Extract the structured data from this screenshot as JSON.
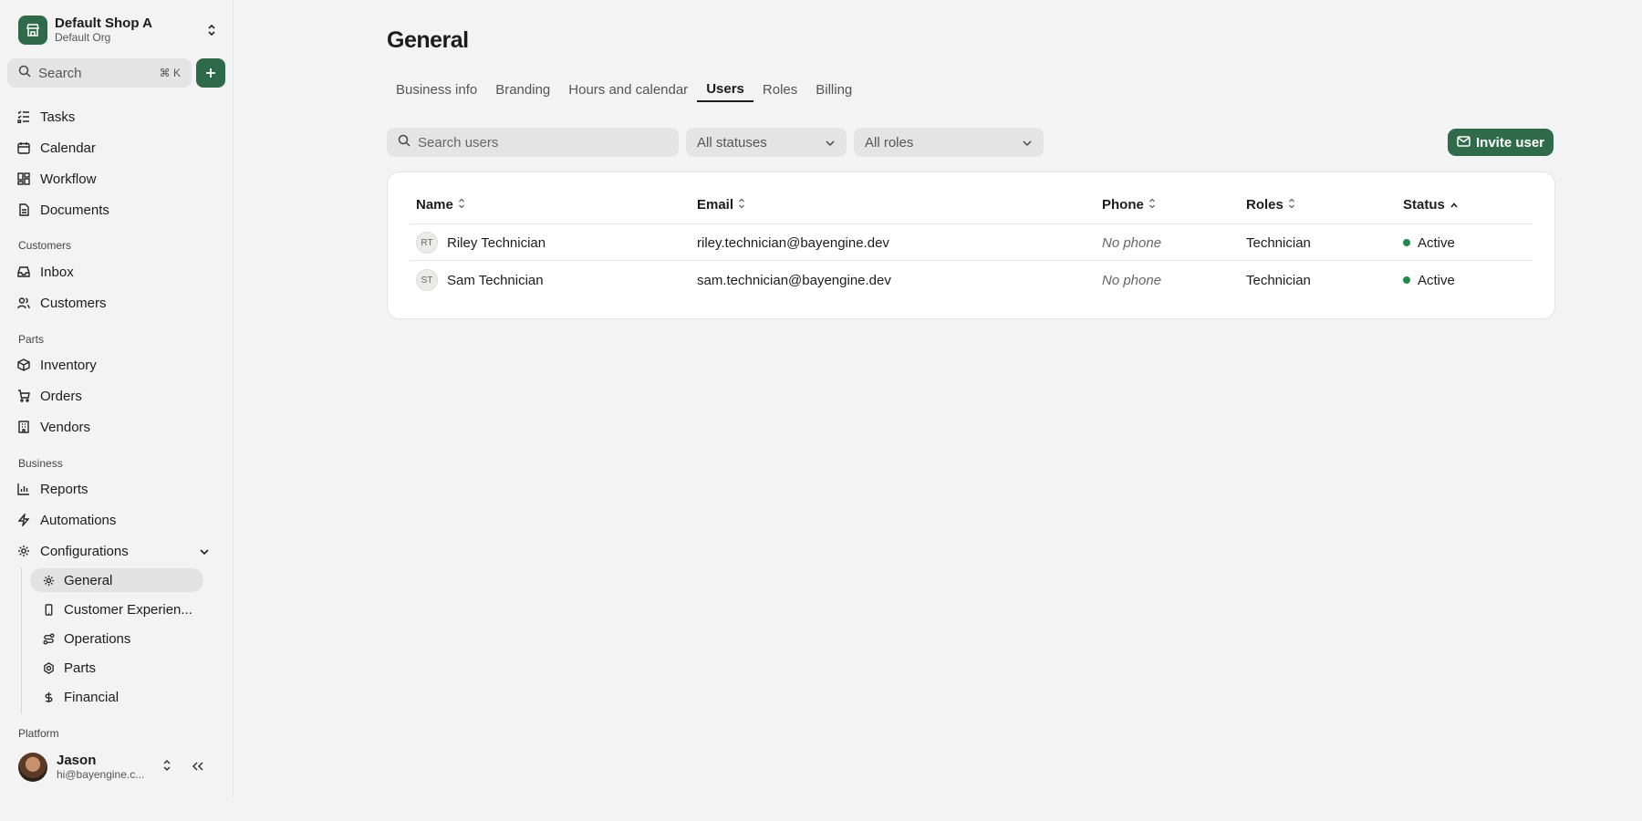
{
  "sidebar": {
    "shop_name": "Default Shop A",
    "org_name": "Default Org",
    "search_label": "Search",
    "search_shortcut": "⌘ K",
    "nav": {
      "tasks": "Tasks",
      "calendar": "Calendar",
      "workflow": "Workflow",
      "documents": "Documents",
      "customers_section": "Customers",
      "inbox": "Inbox",
      "customers": "Customers",
      "parts_section": "Parts",
      "inventory": "Inventory",
      "orders": "Orders",
      "vendors": "Vendors",
      "business_section": "Business",
      "reports": "Reports",
      "automations": "Automations",
      "configurations": "Configurations",
      "platform_section": "Platform"
    },
    "config_items": {
      "general": "General",
      "customer_experience": "Customer Experien...",
      "operations": "Operations",
      "parts": "Parts",
      "financial": "Financial"
    },
    "user": {
      "name": "Jason",
      "email": "hi@bayengine.c..."
    }
  },
  "main": {
    "title": "General",
    "tabs": [
      "Business info",
      "Branding",
      "Hours and calendar",
      "Users",
      "Roles",
      "Billing"
    ],
    "active_tab": "Users",
    "filters": {
      "search_placeholder": "Search users",
      "status_select": "All statuses",
      "roles_select": "All roles"
    },
    "invite_label": "Invite user",
    "table": {
      "columns": [
        "Name",
        "Email",
        "Phone",
        "Roles",
        "Status"
      ],
      "sorted_column": "Status",
      "rows": [
        {
          "initials": "RT",
          "name": "Riley Technician",
          "email": "riley.technician@bayengine.dev",
          "phone": "No phone",
          "role": "Technician",
          "status": "Active"
        },
        {
          "initials": "ST",
          "name": "Sam Technician",
          "email": "sam.technician@bayengine.dev",
          "phone": "No phone",
          "role": "Technician",
          "status": "Active"
        }
      ]
    }
  },
  "colors": {
    "accent": "#2f6b4a",
    "status_active": "#1f8a4c",
    "background": "#f2f3f2"
  }
}
